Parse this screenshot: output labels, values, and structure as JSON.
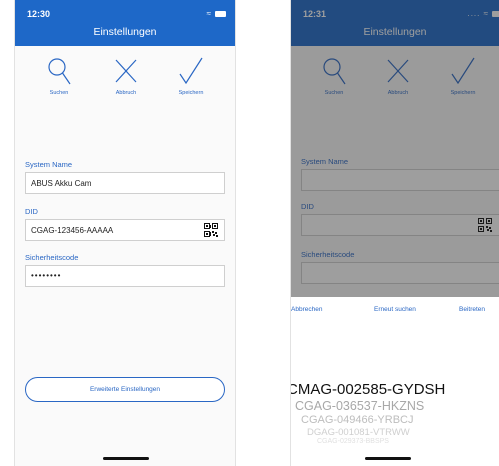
{
  "left_screen": {
    "status_time": "12:30",
    "title": "Einstellungen",
    "actions": [
      {
        "label": "Suchen",
        "icon": "search-icon"
      },
      {
        "label": "Abbruch",
        "icon": "close-icon"
      },
      {
        "label": "Speichern",
        "icon": "checkmark-icon"
      }
    ],
    "system_name_label": "System Name",
    "system_name_value": "ABUS Akku Cam",
    "did_label": "DID",
    "did_value": "CGAG-123456-AAAAA",
    "security_label": "Sicherheitscode",
    "security_value": "••••••••",
    "advanced_button": "Erweiterte Einstellungen"
  },
  "right_screen": {
    "status_time": "12:31",
    "title": "Einstellungen",
    "actions": [
      {
        "label": "Suchen",
        "icon": "search-icon"
      },
      {
        "label": "Abbruch",
        "icon": "close-icon"
      },
      {
        "label": "Speichern",
        "icon": "checkmark-icon"
      }
    ],
    "system_name_label": "System Name",
    "did_label": "DID",
    "security_label": "Sicherheitscode",
    "sheet": {
      "cancel": "Abbrechen",
      "search_again": "Erneut suchen",
      "join": "Beitreten",
      "picker_items": [
        "CMAG-002585-GYDSH",
        "CGAG-036537-HKZNS",
        "CGAG-049466-YRBCJ",
        "DGAG-001081-VTRWW",
        "CGAG-029373-BBSPS"
      ]
    }
  },
  "colors": {
    "header_blue": "#1e68c8",
    "accent_blue": "#2a67c4"
  }
}
